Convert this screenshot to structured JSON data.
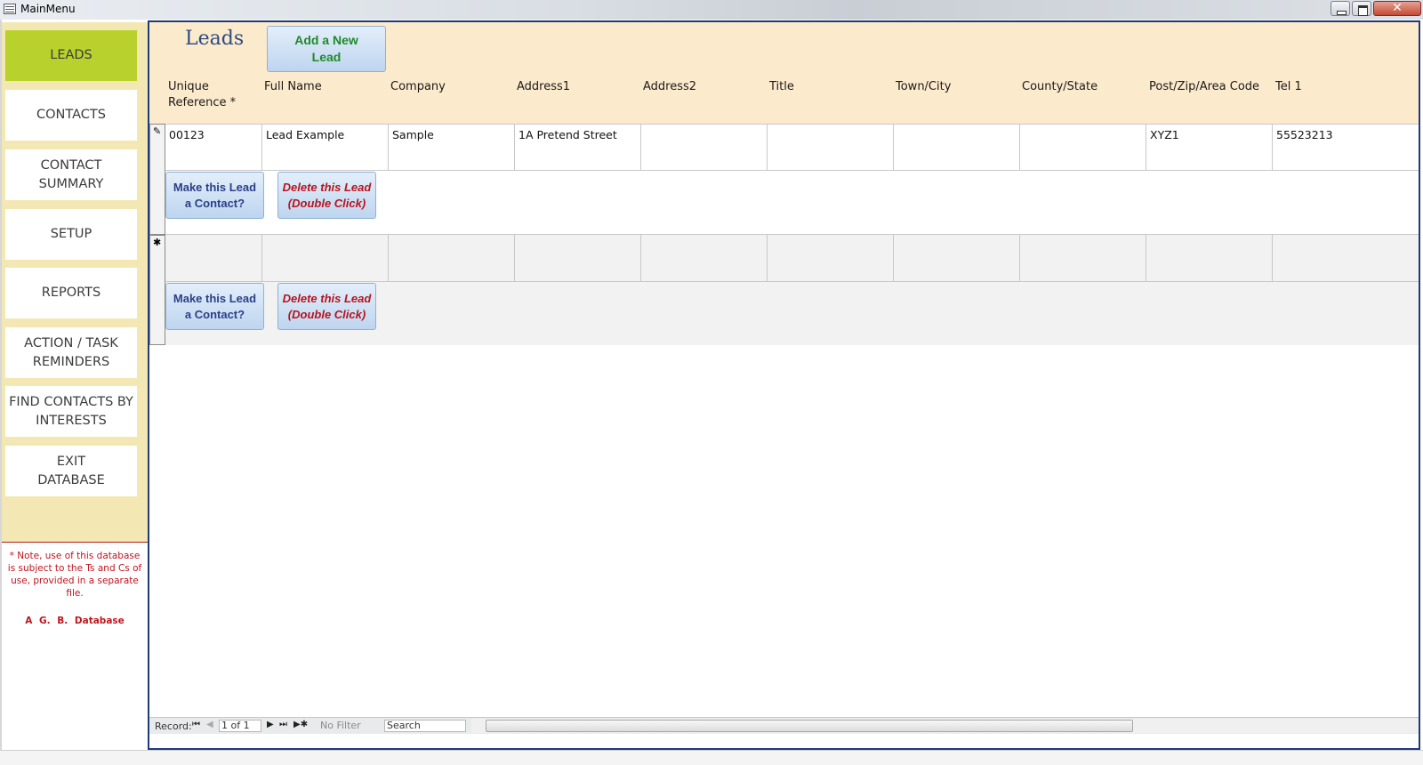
{
  "window": {
    "title": "MainMenu",
    "close_glyph": "✕"
  },
  "sidebar": {
    "items": [
      {
        "label": "LEADS",
        "active": true
      },
      {
        "label": "CONTACTS",
        "active": false
      },
      {
        "label": "CONTACT SUMMARY",
        "active": false
      },
      {
        "label": "SETUP",
        "active": false
      },
      {
        "label": "REPORTS",
        "active": false
      },
      {
        "label": "ACTION / TASK REMINDERS",
        "active": false
      },
      {
        "label": "FIND CONTACTS BY INTERESTS",
        "active": false
      },
      {
        "label": "EXIT DATABASE",
        "active": false
      }
    ],
    "note": "* Note, use of this database is subject to the Ts and Cs of use, provided in a separate file.",
    "brand": "A G. B. Database"
  },
  "form": {
    "title": "Leads",
    "add_button_label": "Add a New Lead",
    "columns": [
      "Unique Reference *",
      "Full Name",
      "Company",
      "Address1",
      "Address2",
      "Title",
      "Town/City",
      "County/State",
      "Post/Zip/Area Code",
      "Tel 1"
    ],
    "records": [
      {
        "selector_glyph": "✎",
        "values": [
          "00123",
          "Lead Example",
          "Sample",
          "1A Pretend Street",
          "",
          "",
          "",
          "",
          "XYZ1",
          "55523213"
        ],
        "make_contact_label": "Make this Lead a Contact?",
        "delete_label": "Delete this Lead (Double Click)"
      },
      {
        "selector_glyph": "✱",
        "values": [
          "",
          "",
          "",
          "",
          "",
          "",
          "",
          "",
          "",
          ""
        ],
        "make_contact_label": "Make this Lead a Contact?",
        "delete_label": "Delete this Lead (Double Click)"
      }
    ]
  },
  "navigation": {
    "record_label": "Record:",
    "record_position": "1 of 1",
    "filter_label": "No Filter",
    "search_placeholder": "Search",
    "first_glyph": "⏮",
    "prev_glyph": "◀",
    "next_glyph": "▶",
    "last_glyph": "⏭",
    "new_glyph": "▶✱"
  }
}
